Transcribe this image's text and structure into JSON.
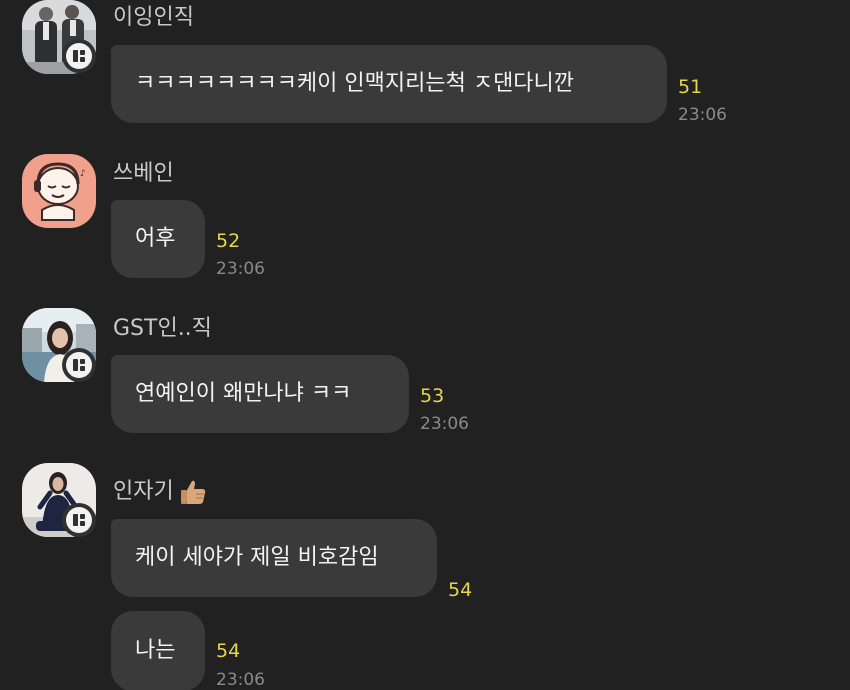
{
  "messages": [
    {
      "sender": "이잉인직",
      "text": "ㅋㅋㅋㅋㅋㅋㅋㅋ케이 인맥지리는척 ㅈ댄다니깐",
      "unread_count": "51",
      "time": "23:06",
      "avatar_icon": "couple-photo-avatar"
    },
    {
      "sender": "쓰베인",
      "text": "어후",
      "unread_count": "52",
      "time": "23:06",
      "avatar_icon": "cartoon-face-headphones-avatar"
    },
    {
      "sender": "GST인..직",
      "text": "연예인이 왜만나냐 ㅋㅋ",
      "unread_count": "53",
      "time": "23:06",
      "avatar_icon": "woman-photo-avatar"
    },
    {
      "sender": "인자기",
      "sender_emoji": "thumbs-up-icon",
      "text": "케이 세야가 제일 비호감임",
      "unread_count": "54",
      "time": "",
      "avatar_icon": "woman-sitting-photo-avatar"
    },
    {
      "sender": "",
      "text": "나는",
      "unread_count": "54",
      "time": "23:06"
    }
  ],
  "colors": {
    "background": "#212121",
    "bubble": "#3a3a3a",
    "unread_count": "#e6d64a",
    "time": "#8a8a8a"
  }
}
